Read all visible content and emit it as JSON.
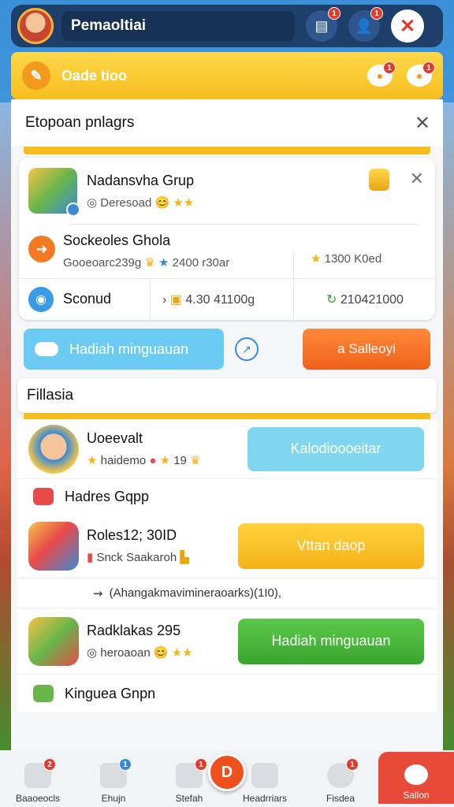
{
  "topbar": {
    "title": "Pemaoltiai",
    "icon1_badge": "1",
    "icon2_badge": "1",
    "close_glyph": "✕"
  },
  "header": {
    "label": "Oade tioo",
    "bubble1_badge": "1",
    "bubble2_badge": "1"
  },
  "section": {
    "title": "Etopoan pnlagrs",
    "close_glyph": "✕"
  },
  "group_card": {
    "name": "Nadansvha Grup",
    "sub": "Deresoad",
    "row2_name": "Sockeoles Ghola",
    "row2_sub": "Gooeoarc239g",
    "row2_mid": "2400 r30ar",
    "row2_right": "1300 K0ed",
    "row3_label": "Sconud",
    "row3_mid": "4.30 41100g",
    "row3_right": "210421000"
  },
  "actions": {
    "left_button": "Hadiah minguauan",
    "right_button": "a Salleoyi"
  },
  "filter": {
    "title": "Fillasia"
  },
  "list": [
    {
      "name": "Uoeevalt",
      "sub": "haidemo",
      "sub2": "19",
      "button": "Kalodioooeitar"
    },
    {
      "group": "Hadres Gqpp"
    },
    {
      "name": "Roles12; 30ID",
      "sub": "Snck Saakaroh",
      "button": "Vttan daop"
    },
    {
      "hint": "(Ahangakmavimineraoarks)(1I0),"
    },
    {
      "name": "Radklakas 295",
      "sub": "heroaoan",
      "button": "Hadiah minguauan"
    },
    {
      "group": "Kinguea Gnpn"
    }
  ],
  "bottomnav": {
    "items": [
      {
        "label": "Baaoeocls",
        "badge": "2"
      },
      {
        "label": "Ehujn",
        "badge": "1"
      },
      {
        "label": "Stefah",
        "badge": "1"
      },
      {
        "label": "Headrriars"
      },
      {
        "label": "Fisdea",
        "badge": "1"
      },
      {
        "label": "Sallon"
      }
    ],
    "center_glyph": "D"
  }
}
